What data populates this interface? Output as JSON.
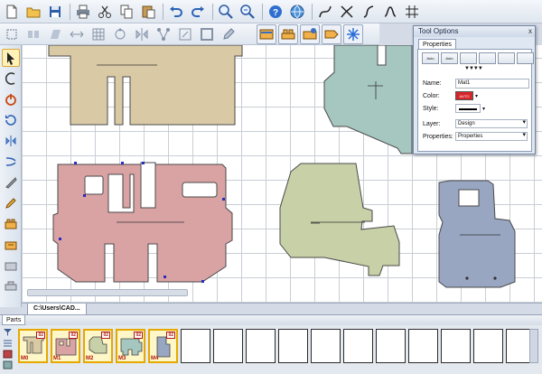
{
  "document": {
    "tab_label": "C:\\Users\\CAD..."
  },
  "parts_panel": {
    "tab_label": "Parts",
    "thumbnails": [
      {
        "label": "M0",
        "count": "02",
        "color": "#d9c9a5"
      },
      {
        "label": "M1",
        "count": "02",
        "color": "#d9a3a4"
      },
      {
        "label": "M2",
        "count": "02",
        "color": "#c7d0a7"
      },
      {
        "label": "M3",
        "count": "02",
        "color": "#a6c7bf"
      },
      {
        "label": "M4",
        "count": "02",
        "color": "#98a6c2"
      }
    ],
    "empty_slots": 11
  },
  "tool_options": {
    "title": "Tool Options",
    "close": "x",
    "tab": "Properties",
    "shape_buttons": [
      "Auto",
      "Auto",
      "",
      "",
      "",
      ""
    ],
    "arrows": "▼▼▼▼",
    "name_label": "Name:",
    "name_value": "Mat1",
    "color_label": "Color:",
    "color_value": "AUTO",
    "color_hex": "#d6262b",
    "style_label": "Style:",
    "layer_label": "Layer:",
    "layer_value": "Design",
    "properties_label": "Properties:",
    "properties_value": "Properties"
  },
  "parts": {
    "tan": "#d9c9a5",
    "green_top": "#a6c7bf",
    "pink": "#d9a3a4",
    "olive": "#c7d0a7",
    "blue": "#98a6c2",
    "outline": "#4a4a4a"
  }
}
